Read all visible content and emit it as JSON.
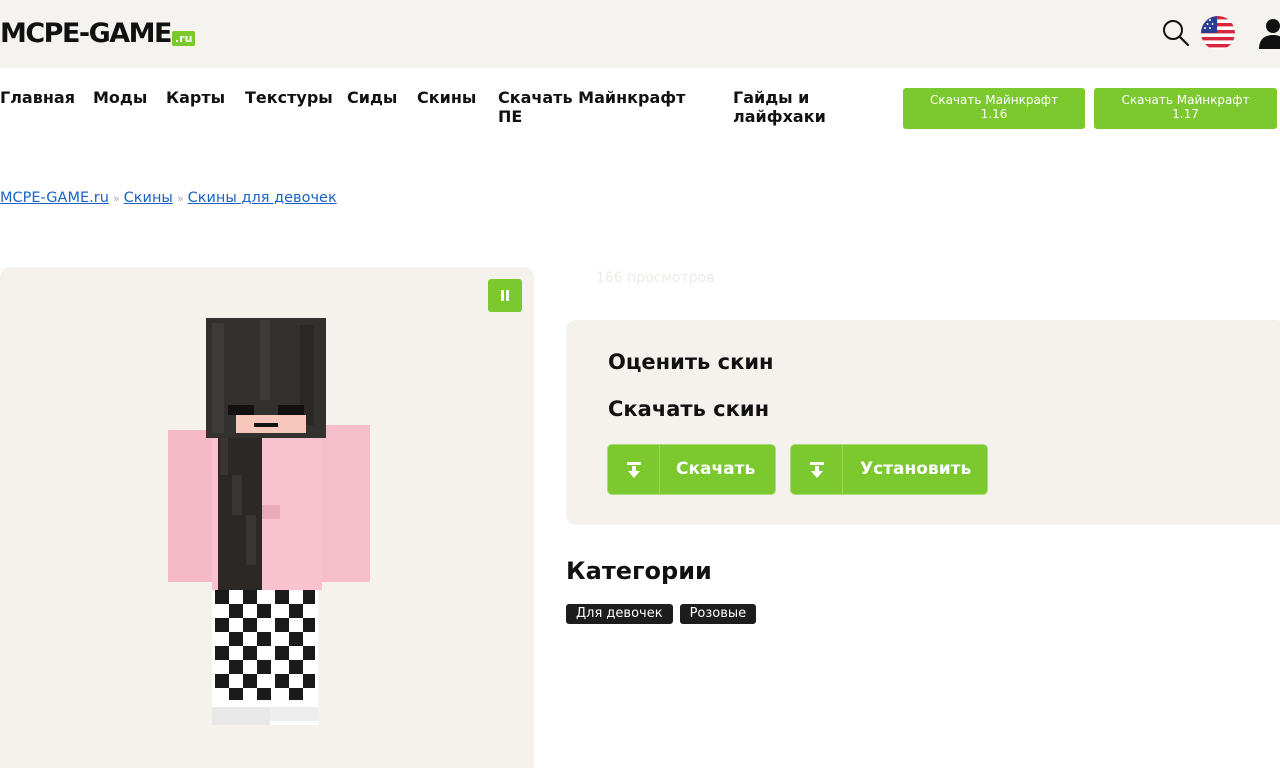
{
  "header": {
    "logo_main": "MCPE-GAME",
    "logo_suffix": ".ru",
    "icons": [
      "search-icon",
      "us-flag-icon",
      "user-icon"
    ]
  },
  "nav": {
    "items": [
      {
        "label": "Главная"
      },
      {
        "label": "Моды"
      },
      {
        "label": "Карты"
      },
      {
        "label": "Текстуры"
      },
      {
        "label": "Сиды"
      },
      {
        "label": "Скины"
      },
      {
        "label_line1": "Скачать Майнкрафт",
        "label_line2": "ПЕ"
      },
      {
        "label_line1": "Гайды и",
        "label_line2": "лайфхаки"
      }
    ],
    "download_buttons": [
      {
        "line1": "Скачать Майнкрафт",
        "line2": "1.16"
      },
      {
        "line1": "Скачать Майнкрафт",
        "line2": "1.17"
      }
    ]
  },
  "breadcrumb": {
    "items": [
      "MCPE-GAME.ru",
      "Скины",
      "Скины для девочек"
    ],
    "separator": "»"
  },
  "viewer": {
    "pause_icon": "pause-icon"
  },
  "views_text": "166 просмотров",
  "card": {
    "rate_heading": "Оценить скин",
    "download_heading": "Скачать скин",
    "download_button": "Скачать",
    "install_button": "Установить",
    "button_icon": "download-arrow-icon"
  },
  "categories": {
    "heading": "Категории",
    "tags": [
      "Для девочек",
      "Розовые"
    ]
  },
  "colors": {
    "accent": "#7bc82f",
    "link": "#1a63c4",
    "panel": "#f5f2ed",
    "tag_bg": "#1d1d1d"
  }
}
